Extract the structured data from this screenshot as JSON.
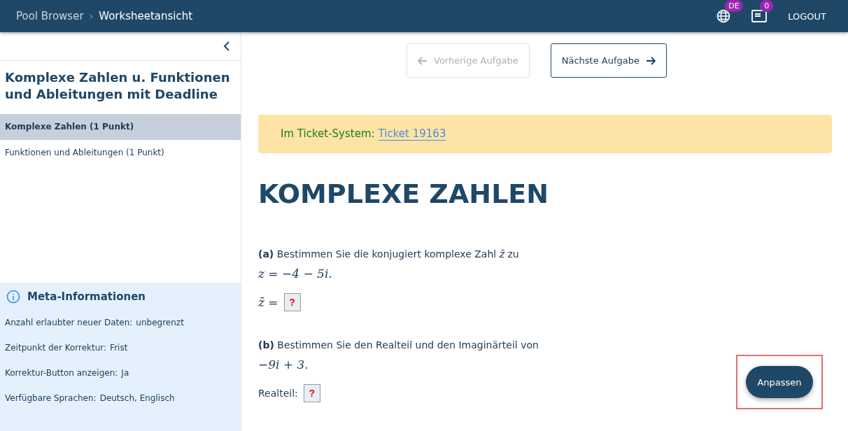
{
  "header": {
    "breadcrumb": [
      {
        "label": "Pool Browser",
        "current": false
      },
      {
        "label": "Worksheetansicht",
        "current": true
      }
    ],
    "separator": "›",
    "language_badge": "DE",
    "messages_badge": "0",
    "logout": "LOGOUT"
  },
  "sidebar": {
    "title": "Komplexe Zahlen u. Funktionen und Ableitungen mit Deadline",
    "items": [
      {
        "label": "Komplexe Zahlen (1 Punkt)",
        "selected": true
      },
      {
        "label": "Funktionen und Ableitungen (1 Punkt)",
        "selected": false
      }
    ],
    "meta": {
      "title": "Meta-Informationen",
      "rows": [
        {
          "label": "Anzahl erlaubter neuer Daten:",
          "value": "unbegrenzt"
        },
        {
          "label": "Zeitpunkt der Korrektur:",
          "value": "Frist"
        },
        {
          "label": "Korrektur-Button anzeigen:",
          "value": "Ja"
        },
        {
          "label": "Verfügbare Sprachen:",
          "value": "Deutsch, Englisch"
        }
      ]
    }
  },
  "nav": [
    {
      "label": "Vorherige Aufgabe",
      "kind": "prev",
      "disabled": true
    },
    {
      "label": "Nächste Aufgabe",
      "kind": "next",
      "disabled": false
    }
  ],
  "notice": {
    "text": "Im Ticket-System:",
    "link": "Ticket 19163"
  },
  "heading": "KOMPLEXE ZAHLEN",
  "parts": [
    {
      "prompt": "**(a)** Bestimmen Sie die konjugiert komplexe Zahl *z̄* zu",
      "formula": "z = −4 − 5i.",
      "answers": [
        {
          "label": "*z̄* =",
          "kind": "math",
          "placeholder": "?"
        }
      ]
    },
    {
      "prompt": "**(b)** Bestimmen Sie den Realteil und den Imaginärteil von",
      "formula": "−9i + 3.",
      "answers": [
        {
          "label": "Realteil:",
          "kind": "text",
          "placeholder": "?"
        }
      ]
    }
  ],
  "fab": {
    "label": "Anpassen",
    "highlighted": true
  }
}
